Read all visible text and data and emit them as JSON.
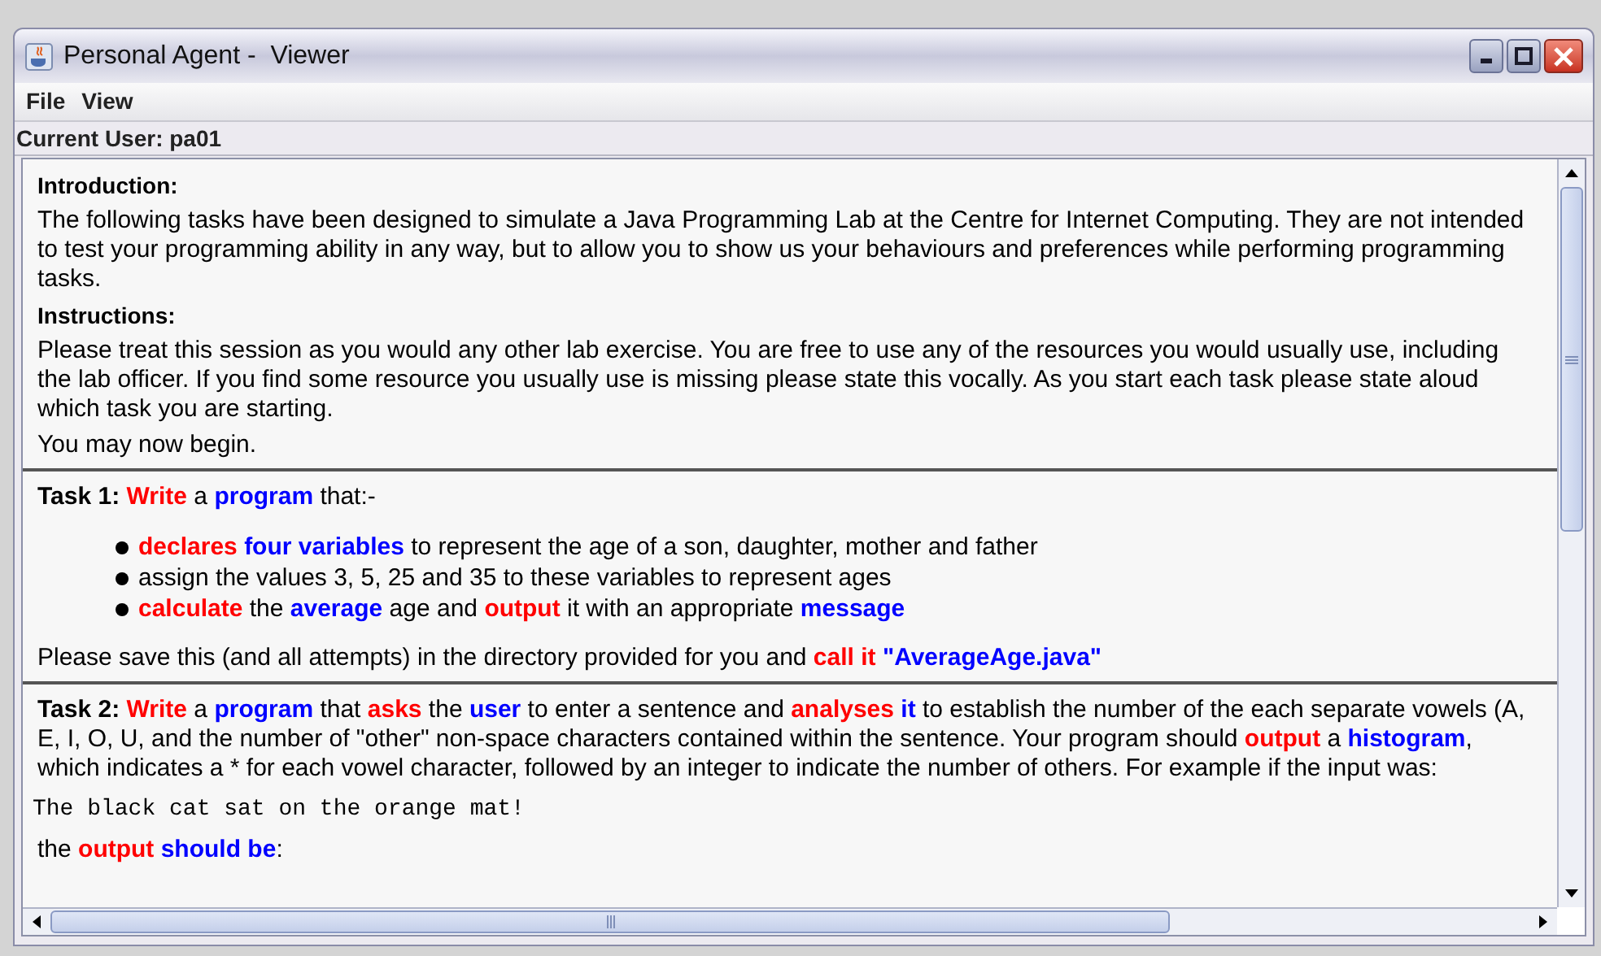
{
  "window": {
    "title": "Personal Agent -  Viewer"
  },
  "menu": [
    {
      "label": "File"
    },
    {
      "label": "View"
    }
  ],
  "current_user": "Current User: pa01",
  "sections": [
    {
      "blocks": [
        {
          "kind": "heading",
          "runs": [
            {
              "text": "Introduction:",
              "color": "#000000"
            }
          ]
        },
        {
          "kind": "paragraph",
          "runs": [
            {
              "text": "The following tasks have been designed to simulate a Java Programming Lab at the Centre for Internet Computing. They are not intended to test your programming ability in any way, but to allow you to show us your behaviours and preferences while performing programming tasks.",
              "color": "#000000"
            }
          ]
        },
        {
          "kind": "heading",
          "runs": [
            {
              "text": "Instructions:",
              "color": "#000000"
            }
          ]
        },
        {
          "kind": "paragraph",
          "runs": [
            {
              "text": "Please treat this session as you would any other lab exercise. You are free to use any of the resources you would usually use, including the lab officer. If you find some resource you usually use is missing please state this vocally. As you start each task please state aloud which task you are starting.",
              "color": "#000000"
            }
          ]
        },
        {
          "kind": "paragraph",
          "runs": [
            {
              "text": "You may now begin.",
              "color": "#000000"
            }
          ]
        }
      ]
    },
    {
      "blocks": [
        {
          "kind": "paragraph",
          "runs": [
            {
              "text": "**Task 1:** ",
              "color": "#000000"
            },
            {
              "text": "**Write**",
              "color": "#ff0000"
            },
            {
              "text": " a ",
              "color": "#000000"
            },
            {
              "text": "**program**",
              "color": "#0000ff"
            },
            {
              "text": " that:-",
              "color": "#000000"
            }
          ]
        },
        {
          "kind": "bullets",
          "items": [
            {
              "runs": [
                {
                  "text": "**declares** ",
                  "color": "#ff0000"
                },
                {
                  "text": "**four variables**",
                  "color": "#0000ff"
                },
                {
                  "text": " to represent the age of a son, daughter, mother and father",
                  "color": "#000000"
                }
              ]
            },
            {
              "runs": [
                {
                  "text": "assign the values 3, 5, 25 and 35 to these variables to represent ages",
                  "color": "#000000"
                }
              ]
            },
            {
              "runs": [
                {
                  "text": "**calculate**",
                  "color": "#ff0000"
                },
                {
                  "text": " the ",
                  "color": "#000000"
                },
                {
                  "text": "**average**",
                  "color": "#0000ff"
                },
                {
                  "text": " age and ",
                  "color": "#000000"
                },
                {
                  "text": "**output**",
                  "color": "#ff0000"
                },
                {
                  "text": " it with an appropriate ",
                  "color": "#000000"
                },
                {
                  "text": "**message**",
                  "color": "#0000ff"
                }
              ]
            }
          ]
        },
        {
          "kind": "paragraph",
          "runs": [
            {
              "text": "Please save this (and all attempts) in the directory provided for you and ",
              "color": "#000000"
            },
            {
              "text": "**call it** ",
              "color": "#ff0000"
            },
            {
              "text": "**\"AverageAge.java\"**",
              "color": "#0000ff"
            }
          ]
        }
      ]
    },
    {
      "blocks": [
        {
          "kind": "paragraph",
          "runs": [
            {
              "text": "**Task 2:** ",
              "color": "#000000"
            },
            {
              "text": "**Write**",
              "color": "#ff0000"
            },
            {
              "text": " a ",
              "color": "#000000"
            },
            {
              "text": "**program**",
              "color": "#0000ff"
            },
            {
              "text": " that ",
              "color": "#000000"
            },
            {
              "text": "**asks**",
              "color": "#ff0000"
            },
            {
              "text": " the ",
              "color": "#000000"
            },
            {
              "text": "**user**",
              "color": "#0000ff"
            },
            {
              "text": " to enter a sentence and ",
              "color": "#000000"
            },
            {
              "text": "**analyses** ",
              "color": "#ff0000"
            },
            {
              "text": "**it**",
              "color": "#0000ff"
            },
            {
              "text": " to establish the number of the each separate vowels (A, E, I, O, U, and the number of \"other\" non-space characters contained within the sentence. Your program should ",
              "color": "#000000"
            },
            {
              "text": "**output**",
              "color": "#ff0000"
            },
            {
              "text": " a ",
              "color": "#000000"
            },
            {
              "text": "**histogram**",
              "color": "#0000ff"
            },
            {
              "text": ", which indicates a * for each vowel character, followed by an integer to indicate the number of others. For example if the input was:",
              "color": "#000000"
            }
          ]
        },
        {
          "kind": "code",
          "runs": [
            {
              "text": "The black cat sat on the orange mat!",
              "color": "#000000"
            }
          ]
        },
        {
          "kind": "paragraph",
          "runs": [
            {
              "text": "the ",
              "color": "#000000"
            },
            {
              "text": "**output** ",
              "color": "#ff0000"
            },
            {
              "text": "**should be**",
              "color": "#0000ff"
            },
            {
              "text": ":",
              "color": "#000000"
            }
          ]
        }
      ]
    }
  ]
}
